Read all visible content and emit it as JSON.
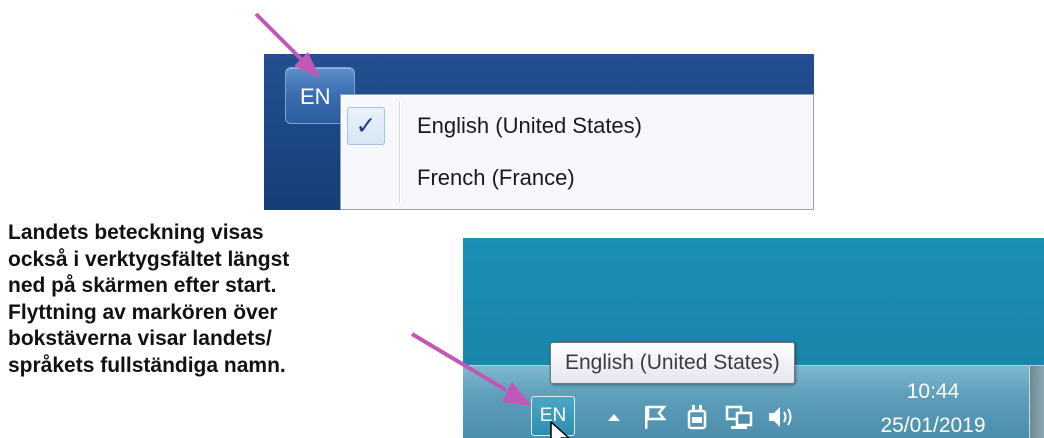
{
  "top_screenshot": {
    "language_button": "EN",
    "menu": {
      "items": [
        {
          "label": "English (United States)",
          "checked": true,
          "check_glyph": "✓"
        },
        {
          "label": "French (France)",
          "checked": false
        }
      ]
    }
  },
  "description": "Landets beteckning visas\nockså i verktygsfältet längst\nned på skärmen efter start.\nFlyttning av markören över\nbokstäverna visar landets/\nspråkets fullständiga namn.",
  "bottom_screenshot": {
    "tooltip": "English (United States)",
    "language_button": "EN",
    "tray_icons": [
      "show-hidden-icons-arrow",
      "action-center-flag-icon",
      "power-plug-icon",
      "network-icon",
      "volume-icon"
    ],
    "clock": {
      "time": "10:44",
      "date": "25/01/2019"
    }
  },
  "colors": {
    "arrow": "#c158b5",
    "top_background": "#1d4a8a",
    "desktop": "#1a8ab0",
    "taskbar": "#5e9fbb"
  }
}
